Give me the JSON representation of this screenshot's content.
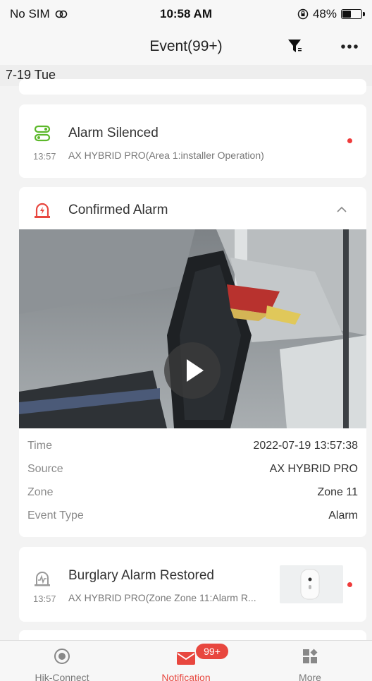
{
  "status_bar": {
    "carrier": "No SIM",
    "time": "10:58 AM",
    "battery": "48%",
    "battery_level": 0.48
  },
  "nav": {
    "title": "Event(99+)",
    "filter_icon": "filter-icon",
    "more_icon": "more-icon"
  },
  "date_header": "7-19 Tue",
  "events": [
    {
      "icon": "alarm-silenced-icon",
      "icon_color": "#5cb82a",
      "title": "Alarm Silenced",
      "time": "13:57",
      "source": "AX HYBRID PRO(Area 1:installer Operation)",
      "unread": true
    },
    {
      "icon": "confirmed-alarm-icon",
      "icon_color": "#e8473f",
      "title": "Confirmed Alarm",
      "expanded": true,
      "details": [
        {
          "key": "Time",
          "value": "2022-07-19 13:57:38"
        },
        {
          "key": "Source",
          "value": "AX HYBRID PRO"
        },
        {
          "key": "Zone",
          "value": "Zone 11"
        },
        {
          "key": "Event Type",
          "value": "Alarm"
        }
      ]
    },
    {
      "icon": "burglary-restored-icon",
      "icon_color": "#999999",
      "title": "Burglary Alarm Restored",
      "time": "13:57",
      "source": "AX HYBRID PRO(Zone Zone 11:Alarm R...",
      "unread": true
    }
  ],
  "tabs": [
    {
      "label": "Hik-Connect",
      "icon": "hik-connect-icon",
      "active": false
    },
    {
      "label": "Notification",
      "icon": "mail-icon",
      "active": true,
      "badge": "99+"
    },
    {
      "label": "More",
      "icon": "more-grid-icon",
      "active": false
    }
  ],
  "colors": {
    "accent": "#e8473f",
    "success": "#5cb82a"
  }
}
